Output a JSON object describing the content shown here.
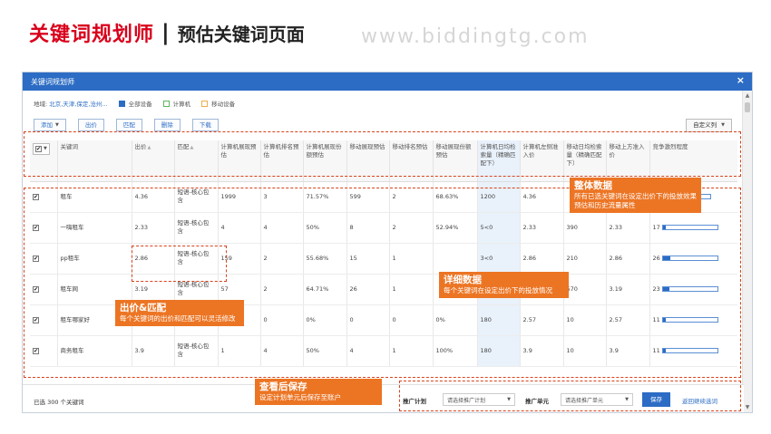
{
  "header": {
    "title_main": "关键词规划师",
    "title_sep": "|",
    "title_sub": "预估关键词页面",
    "site": "www.biddingtg.com"
  },
  "window": {
    "title": "关键词规划师",
    "close": "×",
    "region_label": "地域:",
    "region_value": "北京,天津,保定,沧州...",
    "devices": [
      {
        "label": "全部设备",
        "icon": "square-filled-blue"
      },
      {
        "label": "计算机",
        "icon": "square-outline-green"
      },
      {
        "label": "移动设备",
        "icon": "square-outline-orange"
      }
    ],
    "toolbar": {
      "add": "添加",
      "bid": "出价",
      "match": "匹配",
      "delete": "删除",
      "download": "下载",
      "custom_cols": "自定义列"
    }
  },
  "table": {
    "headers": [
      "关键词",
      "出价",
      "匹配",
      "计算机展现预估",
      "计算机排名预估",
      "计算机展现份额预估",
      "移动展现预估",
      "移动排名预估",
      "移动展现份额预估",
      "计算机日均检索量（精确匹配下）",
      "计算机左侧准入价",
      "移动日均检索量（精确匹配下）",
      "移动上方准入价",
      "竞争激烈程度"
    ],
    "rows": [
      {
        "kw": "租车",
        "bid": "4.36",
        "match": "短语-核心包含",
        "pc_imp": "1999",
        "pc_rank": "3",
        "pc_share": "71.57%",
        "m_imp": "599",
        "m_rank": "2",
        "m_share": "68.63%",
        "pc_search": "1200",
        "pc_price": "4.36",
        "m_search": "",
        "m_price": "",
        "comp": "",
        "comp_level": 0.35
      },
      {
        "kw": "一嗨租车",
        "bid": "2.33",
        "match": "短语-核心包含",
        "pc_imp": "4",
        "pc_rank": "4",
        "pc_share": "50%",
        "m_imp": "8",
        "m_rank": "2",
        "m_share": "52.94%",
        "pc_search": "5<0",
        "pc_price": "2.33",
        "m_search": "390",
        "m_price": "2.33",
        "comp": "17",
        "comp_level": 0.06
      },
      {
        "kw": "pp租车",
        "bid": "2.86",
        "match": "短语-核心包含",
        "pc_imp": "159",
        "pc_rank": "2",
        "pc_share": "55.68%",
        "m_imp": "15",
        "m_rank": "1",
        "m_share": "",
        "pc_search": "3<0",
        "pc_price": "2.86",
        "m_search": "210",
        "m_price": "2.86",
        "comp": "26",
        "comp_level": 0.14
      },
      {
        "kw": "租车网",
        "bid": "3.19",
        "match": "短语-核心包含",
        "pc_imp": "57",
        "pc_rank": "2",
        "pc_share": "64.71%",
        "m_imp": "26",
        "m_rank": "1",
        "m_share": "",
        "pc_search": "",
        "pc_price": "",
        "m_search": "570",
        "m_price": "3.19",
        "comp": "23",
        "comp_level": 0.12
      },
      {
        "kw": "租车哪家好",
        "bid": "",
        "match": "",
        "pc_imp": "",
        "pc_rank": "0",
        "pc_share": "0%",
        "m_imp": "0",
        "m_rank": "0",
        "m_share": "0%",
        "pc_search": "180",
        "pc_price": "2.57",
        "m_search": "10",
        "m_price": "2.57",
        "comp": "11",
        "comp_level": 0.05
      },
      {
        "kw": "商务租车",
        "bid": "3.9",
        "match": "短语-核心包含",
        "pc_imp": "1",
        "pc_rank": "4",
        "pc_share": "50%",
        "m_imp": "4",
        "m_rank": "1",
        "m_share": "100%",
        "pc_search": "180",
        "pc_price": "3.9",
        "m_search": "10",
        "m_price": "3.9",
        "comp": "11",
        "comp_level": 0.05
      }
    ]
  },
  "bottom": {
    "selected": "已选 300 个关键词",
    "plan_label": "推广计划",
    "plan_placeholder": "请选择推广计划",
    "unit_label": "推广单元",
    "unit_placeholder": "请选择推广单元",
    "save": "保存",
    "back": "返回继续选词"
  },
  "callouts": {
    "overall": {
      "title": "整体数据",
      "desc": "所有已选关键词在设定出价下的投放效果预估和历史流量属性"
    },
    "detail": {
      "title": "详细数据",
      "desc": "每个关键词在设定出价下的投放情况"
    },
    "bidmatch": {
      "title": "出价&匹配",
      "desc": "每个关键词的出价和匹配可以灵活修改"
    },
    "save": {
      "title": "查看后保存",
      "desc": "设定计划单元后保存至账户"
    }
  },
  "colors": {
    "brand_blue": "#2c6cc4",
    "title_red": "#d9001b",
    "callout_orange": "#ec7524",
    "dash_red": "#d8431b"
  }
}
